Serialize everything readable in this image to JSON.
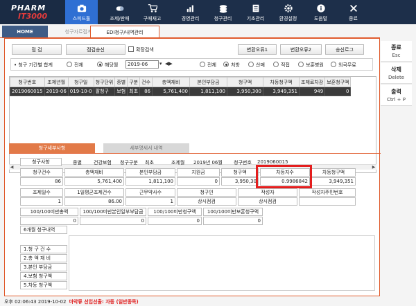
{
  "app": {
    "logo_line1": "PHARM",
    "logo_line2": "IT3000"
  },
  "nav": [
    {
      "label": "스피드툴",
      "icon": "camera-icon",
      "active": true
    },
    {
      "label": "조제/판매",
      "icon": "pills-icon"
    },
    {
      "label": "구매재고",
      "icon": "cart-icon"
    },
    {
      "label": "경영관리",
      "icon": "chart-icon"
    },
    {
      "label": "청구관리",
      "icon": "coins-icon"
    },
    {
      "label": "기초관리",
      "icon": "database-icon"
    },
    {
      "label": "환경설정",
      "icon": "gear-icon"
    },
    {
      "label": "도움말",
      "icon": "help-icon"
    },
    {
      "label": "종료",
      "icon": "close-icon"
    }
  ],
  "tabs": {
    "home": "HOME",
    "t2": "청구자료접계",
    "t3": "EDI청구/내역관리"
  },
  "toolbar": {
    "check": "점    검",
    "check_send": "점검송신",
    "expand_search": "확장검색",
    "error1": "변환오류1",
    "error2": "변환오류2",
    "send_log": "송신로그"
  },
  "filter": {
    "title": "청구 기간별 합계",
    "all1": "전체",
    "month": "해당월",
    "date": "2019-06",
    "all2": "전체",
    "prescription": "처방",
    "sale": "산매",
    "direct": "직접",
    "bohun": "보훈병원",
    "foreign": "외국무료"
  },
  "grid": {
    "headers": [
      "청구번호",
      "조제년월",
      "청구일",
      "청구단위",
      "종별",
      "구분",
      "건수",
      "총액재비",
      "본인부담금",
      "청구액",
      "차등청구액",
      "조제료차감",
      "보훈청구액"
    ],
    "rows": [
      [
        "2019060015",
        "2019-06",
        "019-10-0",
        "팔청구",
        "보험",
        "최초",
        "86",
        "5,761,400",
        "1,811,100",
        "3,950,300",
        "3,949,351",
        "949",
        "0"
      ]
    ]
  },
  "detail_tabs": {
    "on": "청구세부사항",
    "off": "세부명세서 내역"
  },
  "detail": {
    "row1": {
      "l1": "청구사항",
      "v1": "종별",
      "v2": "건강보험",
      "v3": "청구구분",
      "v4": "최초",
      "v5": "조제월",
      "v6": "2019년 06월",
      "v7": "청구번호",
      "v8": "2019060015"
    },
    "row2_labels": [
      "청구건수",
      "총액재비",
      "본인부담금",
      "지원금",
      "청구액",
      "차등지수",
      "차등청구액"
    ],
    "row2_values": [
      "86",
      "5,761,400",
      "1,811,100",
      "0",
      "3,950,30",
      "0.9986842",
      "3,949,351"
    ],
    "row3_labels": [
      "조제일수",
      "1일평균조제건수",
      "근무약사수",
      "청구인",
      "작성자",
      "작성자주민번호"
    ],
    "row3_values": [
      "1",
      "86.00",
      "1",
      "상시점검",
      "상시점검",
      ""
    ],
    "row4_labels": [
      "100/100미만총액",
      "100/100미만본인일부부담금",
      "100/100미만청구액",
      "100/100미만보훈청구액"
    ],
    "row4_values": [
      "0",
      "0",
      "0",
      "0"
    ]
  },
  "history": {
    "title": "6개월 청구내역",
    "items": [
      "1.청 구  건 수",
      "2.총 액 재 비",
      "3.본인 부담금",
      "4.보험 청구액",
      "5.차등 청구액"
    ]
  },
  "side": [
    {
      "label": "종료",
      "sub": "Esc"
    },
    {
      "label": "삭제",
      "sub": "Delete"
    },
    {
      "label": "출력",
      "sub": "Ctrl + P"
    }
  ],
  "status": {
    "time": "오후 02:06:43 2019-10-02",
    "warning": "마약류 선입선출: 자동 (일반종목)"
  },
  "colors": {
    "accent": "#e05a2b",
    "nav_bg": "#1d2f4a",
    "nav_active": "#2f6fd3",
    "highlight": "#e41e1e"
  }
}
